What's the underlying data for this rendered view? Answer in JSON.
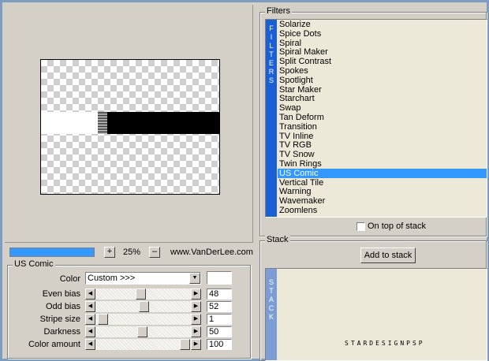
{
  "preview": {},
  "zoom": {
    "plus": "+",
    "value": "25%",
    "minus": "–",
    "credit": "www.VanDerLee.com",
    "progress": 1.0
  },
  "params": {
    "title": "US Comic",
    "color": {
      "label": "Color",
      "value": "Custom >>>"
    },
    "sliders": [
      {
        "label": "Even bias",
        "value": "48"
      },
      {
        "label": "Odd bias",
        "value": "52"
      },
      {
        "label": "Stripe size",
        "value": "1"
      },
      {
        "label": "Darkness",
        "value": "50"
      },
      {
        "label": "Color amount",
        "value": "100"
      }
    ]
  },
  "filters": {
    "title": "Filters",
    "strip": [
      "F",
      "I",
      "L",
      "T",
      "E",
      "R",
      "S"
    ],
    "items": [
      "Solarize",
      "Spice Dots",
      "Spiral",
      "Spiral Maker",
      "Split Contrast",
      "Spokes",
      "Spotlight",
      "Star Maker",
      "Starchart",
      "Swap",
      "Tan Deform",
      "Transition",
      "TV Inline",
      "TV RGB",
      "TV Snow",
      "Twin Rings",
      "US Comic",
      "Vertical Tile",
      "Warning",
      "Wavemaker",
      "Zoomlens"
    ],
    "selected": "US Comic",
    "ontop_label": "On top of stack"
  },
  "stack": {
    "title": "Stack",
    "add_label": "Add to stack",
    "strip": [
      "S",
      "T",
      "A",
      "C",
      "K"
    ],
    "watermark": "STARDESIGNPSP"
  },
  "colors": {
    "accent": "#3399ff",
    "strip": "#1a5fd6"
  }
}
